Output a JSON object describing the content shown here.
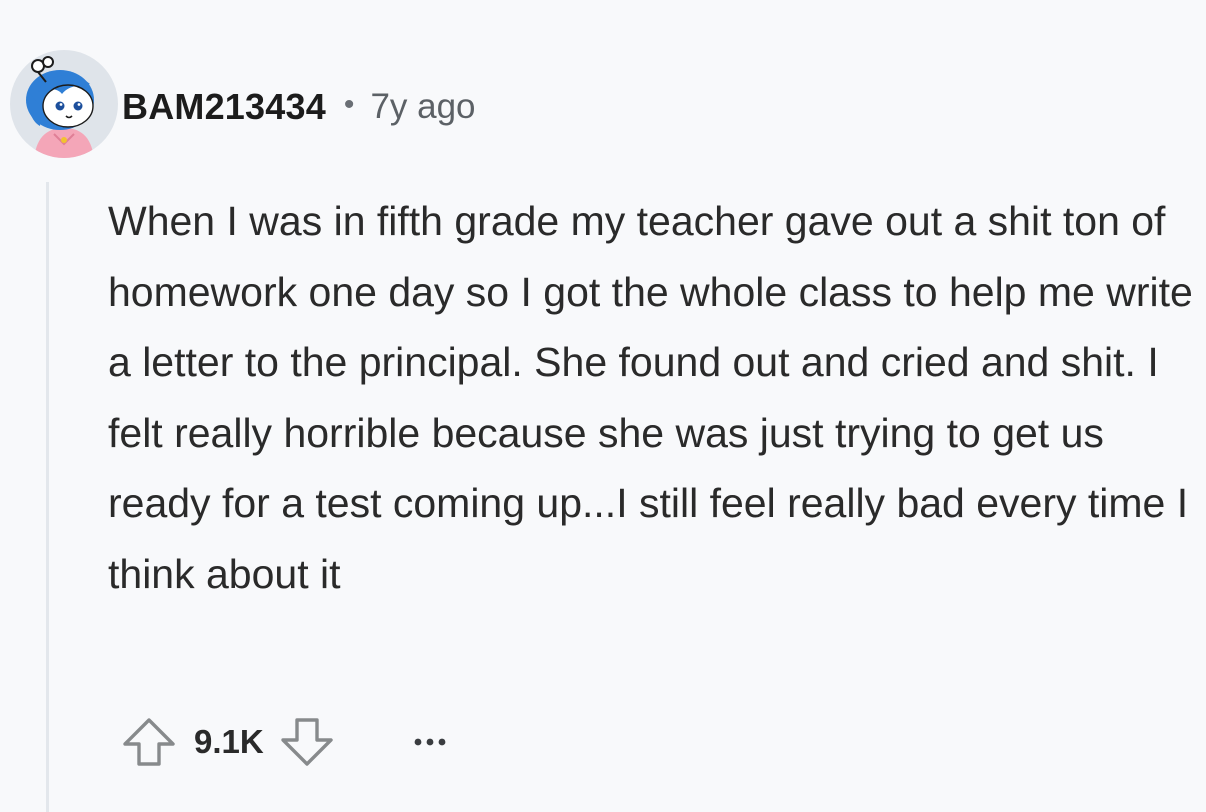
{
  "comment": {
    "author": "BAM213434",
    "separator": "•",
    "timestamp": "7y ago",
    "body": "When I was in fifth grade my teacher gave out a shit ton of homework one day so I got the whole class to help me write a letter to the principal. She found out and cried and shit. I felt really horrible because she was just trying to get us ready for a test coming up...I still feel really bad every time I think about it",
    "avatar_icon": "snoo-avatar-icon",
    "votes": {
      "score": "9.1K",
      "upvote_icon": "arrow-up-icon",
      "downvote_icon": "arrow-down-icon"
    },
    "more_icon": "more-options-icon"
  },
  "colors": {
    "background": "#f8f9fb",
    "thread_line": "#e3e7ec",
    "text": "#1c1c1c",
    "meta_text": "#5c6166",
    "icon_gray": "#878a8c"
  }
}
